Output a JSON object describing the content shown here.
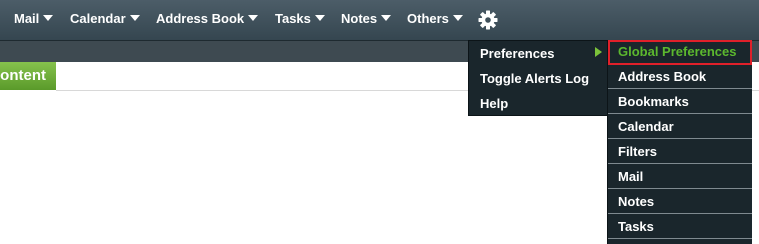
{
  "nav": {
    "items": [
      {
        "label": "Mail"
      },
      {
        "label": "Calendar"
      },
      {
        "label": "Address Book"
      },
      {
        "label": "Tasks"
      },
      {
        "label": "Notes"
      },
      {
        "label": "Others"
      }
    ],
    "gear_icon": "gear-icon"
  },
  "content_tab": {
    "label": "ontent"
  },
  "gear_menu": {
    "items": [
      {
        "label": "Preferences",
        "has_submenu": true
      },
      {
        "label": "Toggle Alerts Log"
      },
      {
        "label": "Help"
      }
    ]
  },
  "preferences_submenu": {
    "items": [
      {
        "label": "Global Preferences",
        "highlighted": true
      },
      {
        "label": "Address Book"
      },
      {
        "label": "Bookmarks"
      },
      {
        "label": "Calendar"
      },
      {
        "label": "Filters"
      },
      {
        "label": "Mail"
      },
      {
        "label": "Notes"
      },
      {
        "label": "Tasks"
      }
    ]
  },
  "colors": {
    "topbar": "#3f505a",
    "menu_bg": "#1a262c",
    "accent_green": "#5cb82e",
    "highlight_border": "#e0202a"
  }
}
